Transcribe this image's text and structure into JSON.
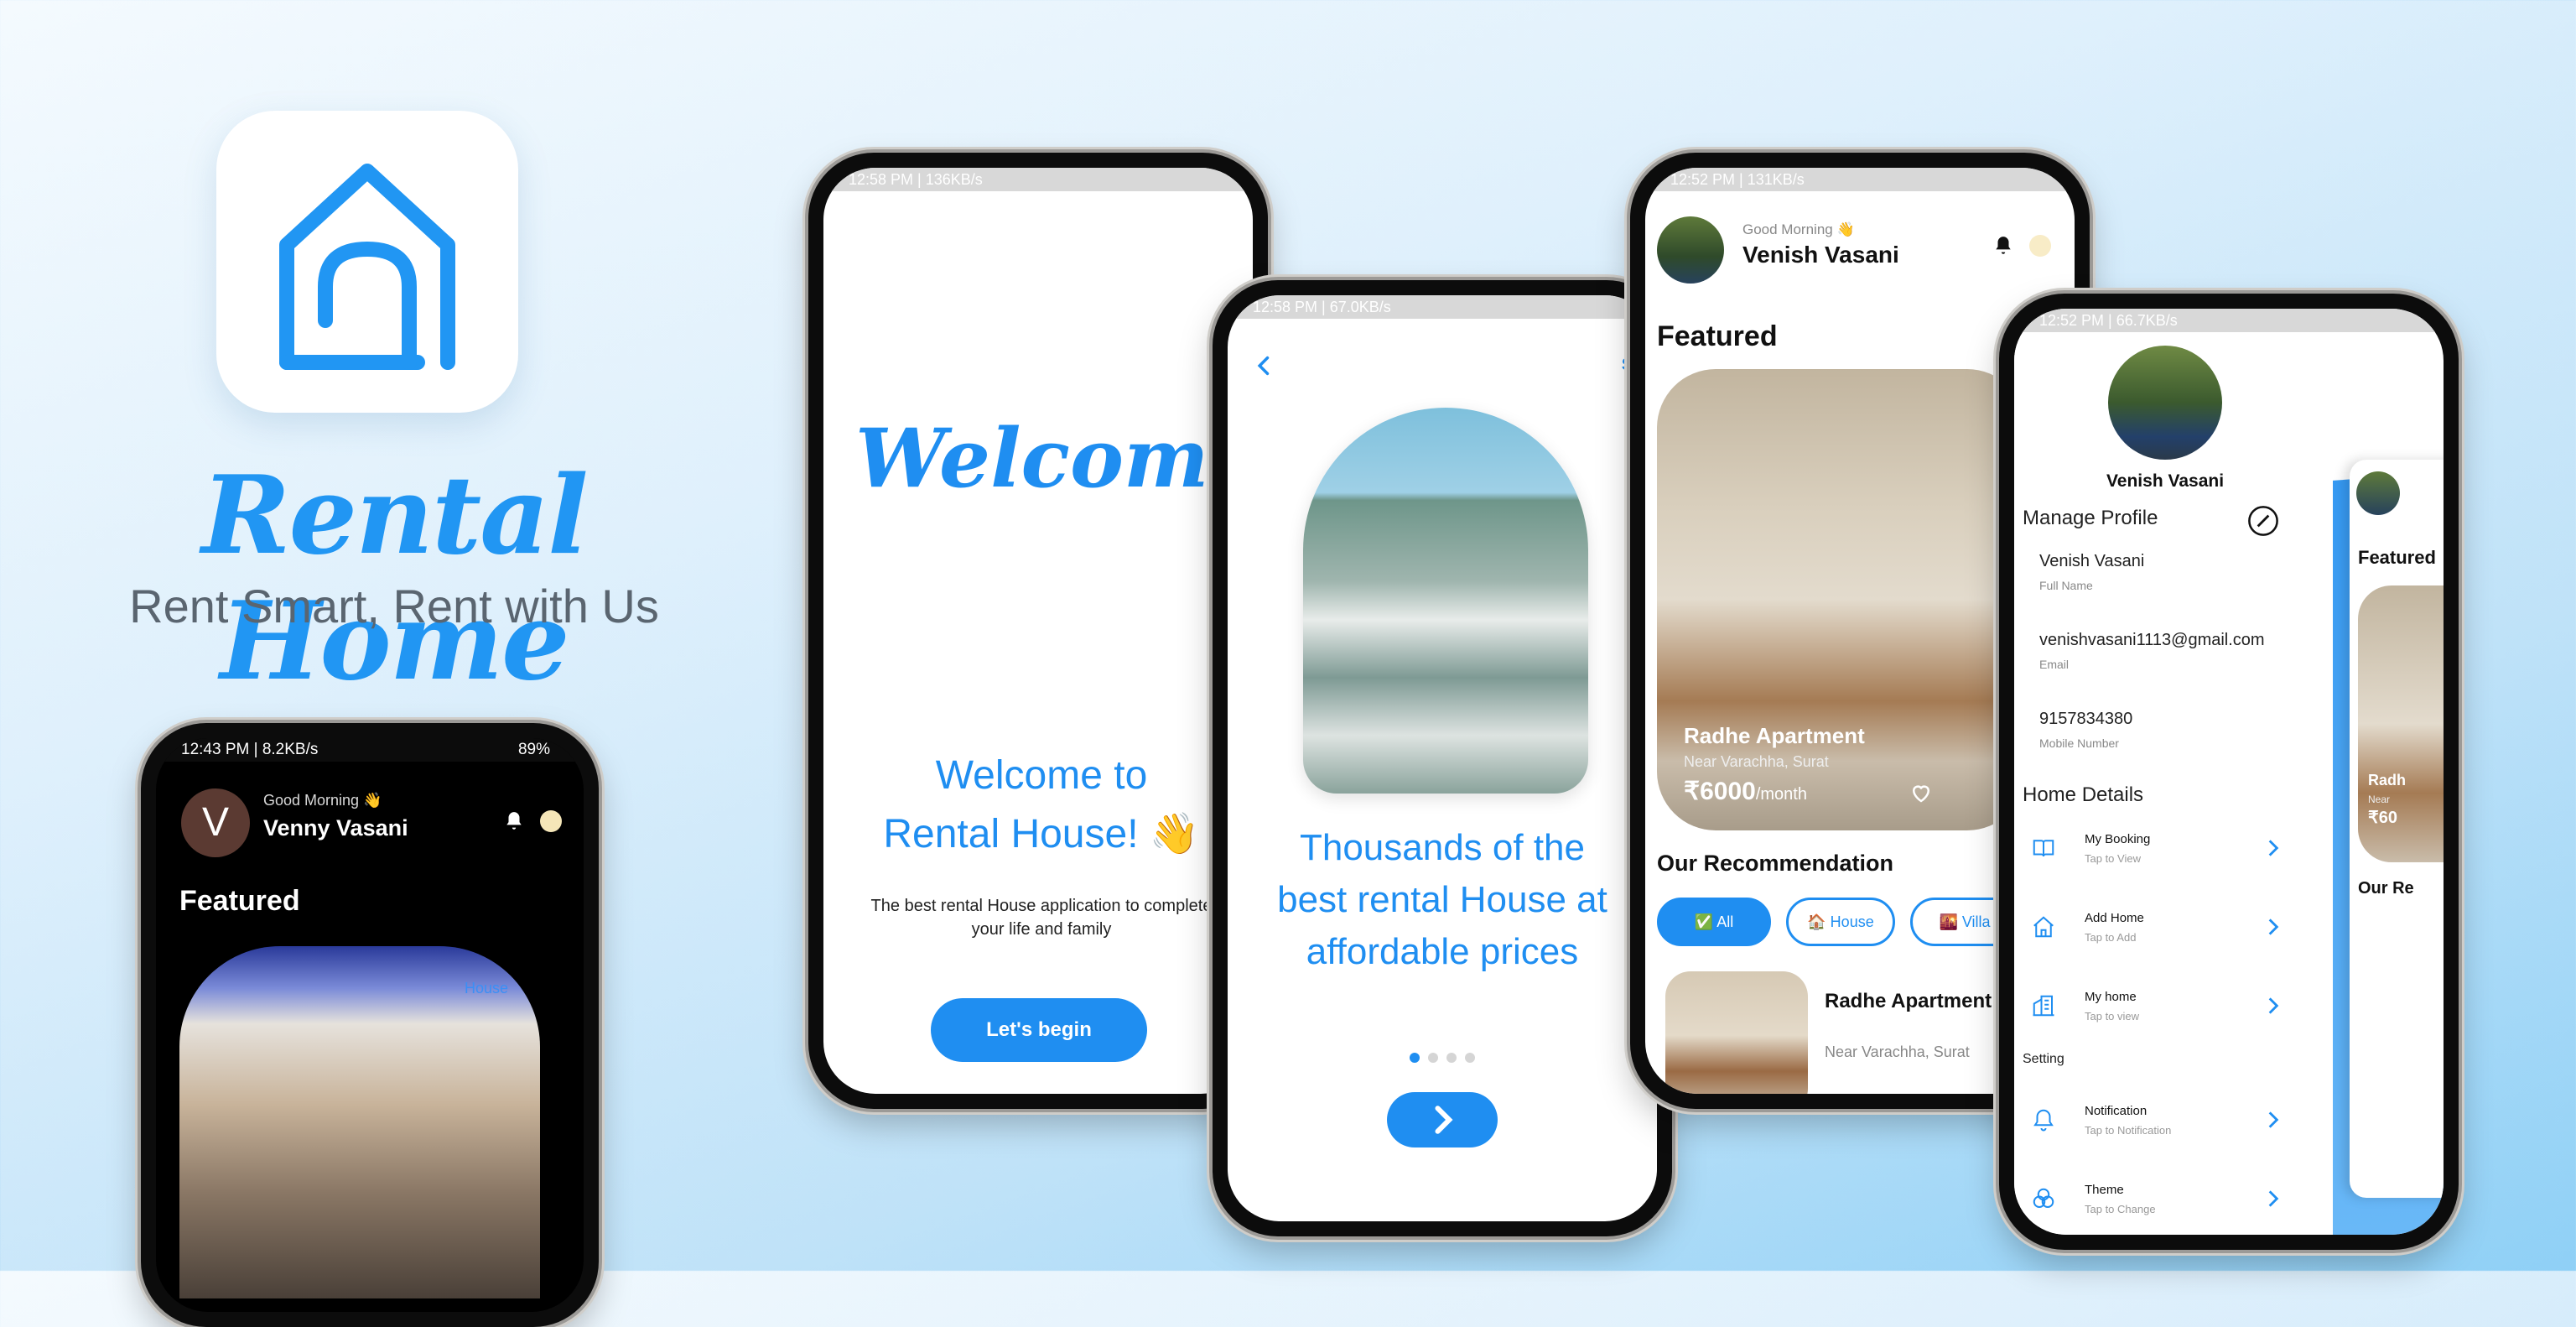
{
  "hero": {
    "title": "Rental Home",
    "tagline": "Rent Smart, Rent with Us",
    "accent": "#2196f3",
    "icon": "house-outline-icon"
  },
  "phone_dark": {
    "status_left": "12:43 PM | 8.2KB/s",
    "status_right": "89%",
    "greeting": "Good Morning 👋",
    "avatar_letter": "V",
    "user_name": "Venny Vasani",
    "section_title": "Featured",
    "card_tag": "House"
  },
  "phone_welcome": {
    "status_left": "12:58 PM | 136KB/s",
    "script_title": "Welcome!",
    "heading_line1": "Welcome to",
    "heading_line2": "Rental House! 👋",
    "body_line1": "The best rental House application to complete",
    "body_line2": "your life and family",
    "cta": "Let's begin"
  },
  "phone_onboard": {
    "status_left": "12:58 PM | 67.0KB/s",
    "skip": "Skip",
    "heading_line1": "Thousands of the",
    "heading_line2": "best rental House at",
    "heading_line3": "affordable prices",
    "active_dot": 1,
    "total_dots": 4
  },
  "phone_home": {
    "status_left": "12:52 PM | 131KB/s",
    "greeting": "Good Morning 👋",
    "user_name": "Venish Vasani",
    "featured_title": "Featured",
    "card_name": "Radhe Apartment",
    "card_location": "Near Varachha, Surat",
    "card_price": "₹6000",
    "card_period": "/month",
    "recommend_title": "Our Recommendation",
    "chips": [
      "✅ All",
      "🏠 House",
      "🌇 Villa"
    ],
    "rec_name": "Radhe Apartment",
    "rec_location": "Near Varachha, Surat"
  },
  "phone_profile": {
    "status_left": "12:52 PM | 66.7KB/s",
    "user_name": "Venish Vasani",
    "manage_title": "Manage Profile",
    "fields": [
      {
        "value": "Venish Vasani",
        "label": "Full Name"
      },
      {
        "value": "venishvasani1113@gmail.com",
        "label": "Email"
      },
      {
        "value": "9157834380",
        "label": "Mobile Number"
      }
    ],
    "home_details_title": "Home Details",
    "home_rows": [
      {
        "title": "My Booking",
        "sub": "Tap to View",
        "icon": "book-icon"
      },
      {
        "title": "Add Home",
        "sub": "Tap to Add",
        "icon": "home-icon"
      },
      {
        "title": "My home",
        "sub": "Tap to view",
        "icon": "building-icon"
      }
    ],
    "setting_title": "Setting",
    "setting_rows": [
      {
        "title": "Notification",
        "sub": "Tap to Notification",
        "icon": "bell-icon"
      },
      {
        "title": "Theme",
        "sub": "Tap to Change",
        "icon": "theme-icon"
      }
    ],
    "peek_featured": "Featured",
    "peek_rec": "Our Re",
    "peek_name": "Radh",
    "peek_loc": "Near",
    "peek_price": "₹60"
  }
}
